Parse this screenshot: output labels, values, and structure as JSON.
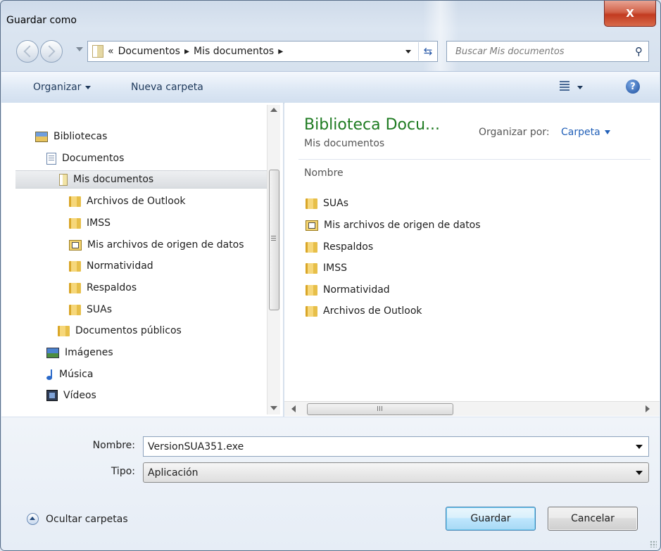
{
  "window": {
    "title": "Guardar como",
    "close_glyph": "X"
  },
  "address": {
    "prefix": "«",
    "crumbs": [
      "Documentos",
      "Mis documentos"
    ],
    "separator": "▸"
  },
  "search": {
    "placeholder": "Buscar Mis documentos"
  },
  "toolbar": {
    "organize": "Organizar",
    "new_folder": "Nueva carpeta",
    "help_glyph": "?"
  },
  "nav": {
    "items": [
      {
        "label": "Bibliotecas",
        "icon": "libraries-icon"
      },
      {
        "label": "Documentos",
        "icon": "documents-library-icon"
      },
      {
        "label": "Mis documentos",
        "icon": "my-documents-icon",
        "selected": true
      },
      {
        "label": "Archivos de Outlook",
        "icon": "folder-icon"
      },
      {
        "label": "IMSS",
        "icon": "folder-icon"
      },
      {
        "label": "Mis archivos de origen de datos",
        "icon": "data-source-folder-icon"
      },
      {
        "label": "Normatividad",
        "icon": "folder-icon"
      },
      {
        "label": "Respaldos",
        "icon": "folder-icon"
      },
      {
        "label": "SUAs",
        "icon": "folder-icon"
      },
      {
        "label": "Documentos públicos",
        "icon": "folder-icon"
      },
      {
        "label": "Imágenes",
        "icon": "pictures-library-icon"
      },
      {
        "label": "Música",
        "icon": "music-library-icon"
      },
      {
        "label": "Vídeos",
        "icon": "videos-library-icon"
      }
    ]
  },
  "content": {
    "title": "Biblioteca Docu...",
    "subtitle": "Mis documentos",
    "arrange_label": "Organizar por:",
    "arrange_value": "Carpeta",
    "column_header": "Nombre",
    "files": [
      {
        "label": "SUAs",
        "icon": "folder-icon"
      },
      {
        "label": "Mis archivos de origen de datos",
        "icon": "data-source-folder-icon"
      },
      {
        "label": "Respaldos",
        "icon": "folder-icon"
      },
      {
        "label": "IMSS",
        "icon": "folder-icon"
      },
      {
        "label": "Normatividad",
        "icon": "folder-icon"
      },
      {
        "label": "Archivos de Outlook",
        "icon": "folder-icon"
      }
    ]
  },
  "form": {
    "name_label": "Nombre:",
    "name_value": "VersionSUA351.exe",
    "type_label": "Tipo:",
    "type_value": "Aplicación"
  },
  "footer": {
    "hide_folders": "Ocultar carpetas",
    "save": "Guardar",
    "cancel": "Cancelar"
  }
}
